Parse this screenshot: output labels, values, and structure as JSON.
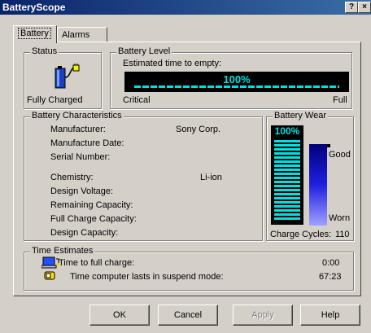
{
  "window": {
    "title": "BatteryScope"
  },
  "titlebar_buttons": {
    "help": "?",
    "close": "×"
  },
  "tabs": [
    {
      "label": "Battery",
      "selected": true
    },
    {
      "label": "Alarms",
      "selected": false
    }
  ],
  "status": {
    "group_title": "Status",
    "icon": "battery-plug-icon",
    "text": "Fully Charged"
  },
  "battery_level": {
    "group_title": "Battery Level",
    "subtitle": "Estimated time to empty:",
    "percent_label": "100%",
    "level": 1.0,
    "min_label": "Critical",
    "max_label": "Full"
  },
  "characteristics": {
    "group_title": "Battery Characteristics",
    "rows": [
      {
        "label": "Manufacturer:",
        "value": "Sony Corp."
      },
      {
        "label": "Manufacture Date:",
        "value": ""
      },
      {
        "label": "Serial Number:",
        "value": ""
      },
      {
        "label": "Chemistry:",
        "value": "Li-ion"
      },
      {
        "label": "Design Voltage:",
        "value": ""
      },
      {
        "label": "Remaining Capacity:",
        "value": ""
      },
      {
        "label": "Full Charge Capacity:",
        "value": ""
      },
      {
        "label": "Design Capacity:",
        "value": ""
      }
    ]
  },
  "wear": {
    "group_title": "Battery Wear",
    "percent_label": "100%",
    "level": 1.0,
    "top_label": "Good",
    "bottom_label": "Worn",
    "cycles_label": "Charge Cycles:",
    "cycles_value": "110"
  },
  "time_estimates": {
    "group_title": "Time Estimates",
    "rows": [
      {
        "icon": "laptop-charge-icon",
        "label": "Time to full charge:",
        "value": "0:00"
      },
      {
        "icon": "suspend-icon",
        "label": "Time computer lasts in suspend mode:",
        "value": "67:23"
      }
    ]
  },
  "buttons": {
    "ok": "OK",
    "cancel": "Cancel",
    "apply": "Apply",
    "help": "Help"
  },
  "colors": {
    "meter_fill": "#00e0e0",
    "meter_bg": "#000000",
    "wear_gradient_top": "#000080",
    "wear_gradient_bottom": "#8080ff"
  }
}
